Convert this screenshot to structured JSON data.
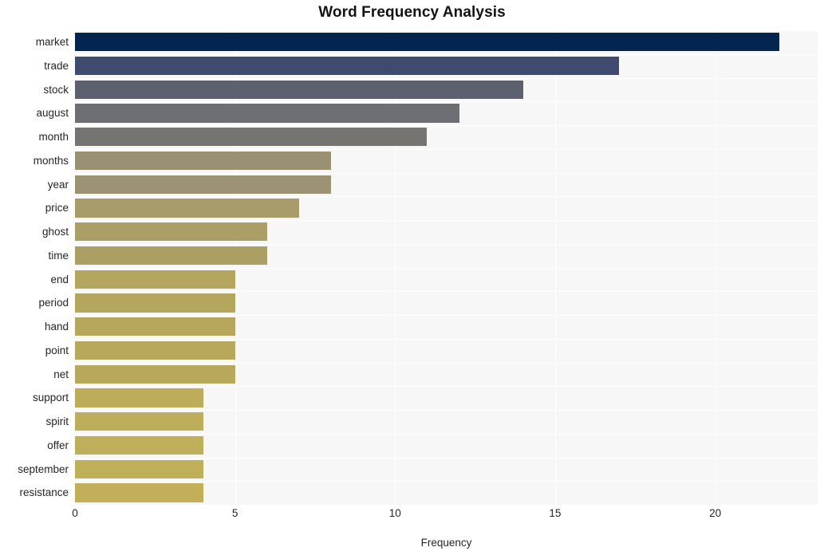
{
  "chart_data": {
    "type": "bar",
    "orientation": "horizontal",
    "title": "Word Frequency Analysis",
    "xlabel": "Frequency",
    "ylabel": "",
    "categories": [
      "market",
      "trade",
      "stock",
      "august",
      "month",
      "months",
      "year",
      "price",
      "ghost",
      "time",
      "end",
      "period",
      "hand",
      "point",
      "net",
      "support",
      "spirit",
      "offer",
      "september",
      "resistance"
    ],
    "values": [
      22,
      17,
      14,
      12,
      11,
      8,
      8,
      7,
      6,
      6,
      5,
      5,
      5,
      5,
      5,
      4,
      4,
      4,
      4,
      4
    ],
    "bar_colors": [
      "#042550",
      "#3f4b6e",
      "#5d606f",
      "#6e6f74",
      "#757471",
      "#9a9175",
      "#9c9374",
      "#a79c6a",
      "#ab9f65",
      "#ac9f63",
      "#b4a65e",
      "#b5a65d",
      "#b6a75d",
      "#b7a85c",
      "#b8a85c",
      "#bdad5b",
      "#bead5a",
      "#bfae5a",
      "#c0af59",
      "#c1b059"
    ],
    "x_ticks": [
      0,
      5,
      10,
      15,
      20
    ],
    "xlim": [
      0,
      23.2
    ],
    "ylim_count": 20,
    "grid": true,
    "grid_color": "#ffffff",
    "plot_background": "#f7f7f7",
    "figure_background": "#ffffff",
    "legend": null
  },
  "axes": {
    "x_axis_title": "Frequency",
    "x_tick_labels": [
      "0",
      "5",
      "10",
      "15",
      "20"
    ],
    "y_tick_labels": [
      "market",
      "trade",
      "stock",
      "august",
      "month",
      "months",
      "year",
      "price",
      "ghost",
      "time",
      "end",
      "period",
      "hand",
      "point",
      "net",
      "support",
      "spirit",
      "offer",
      "september",
      "resistance"
    ]
  }
}
